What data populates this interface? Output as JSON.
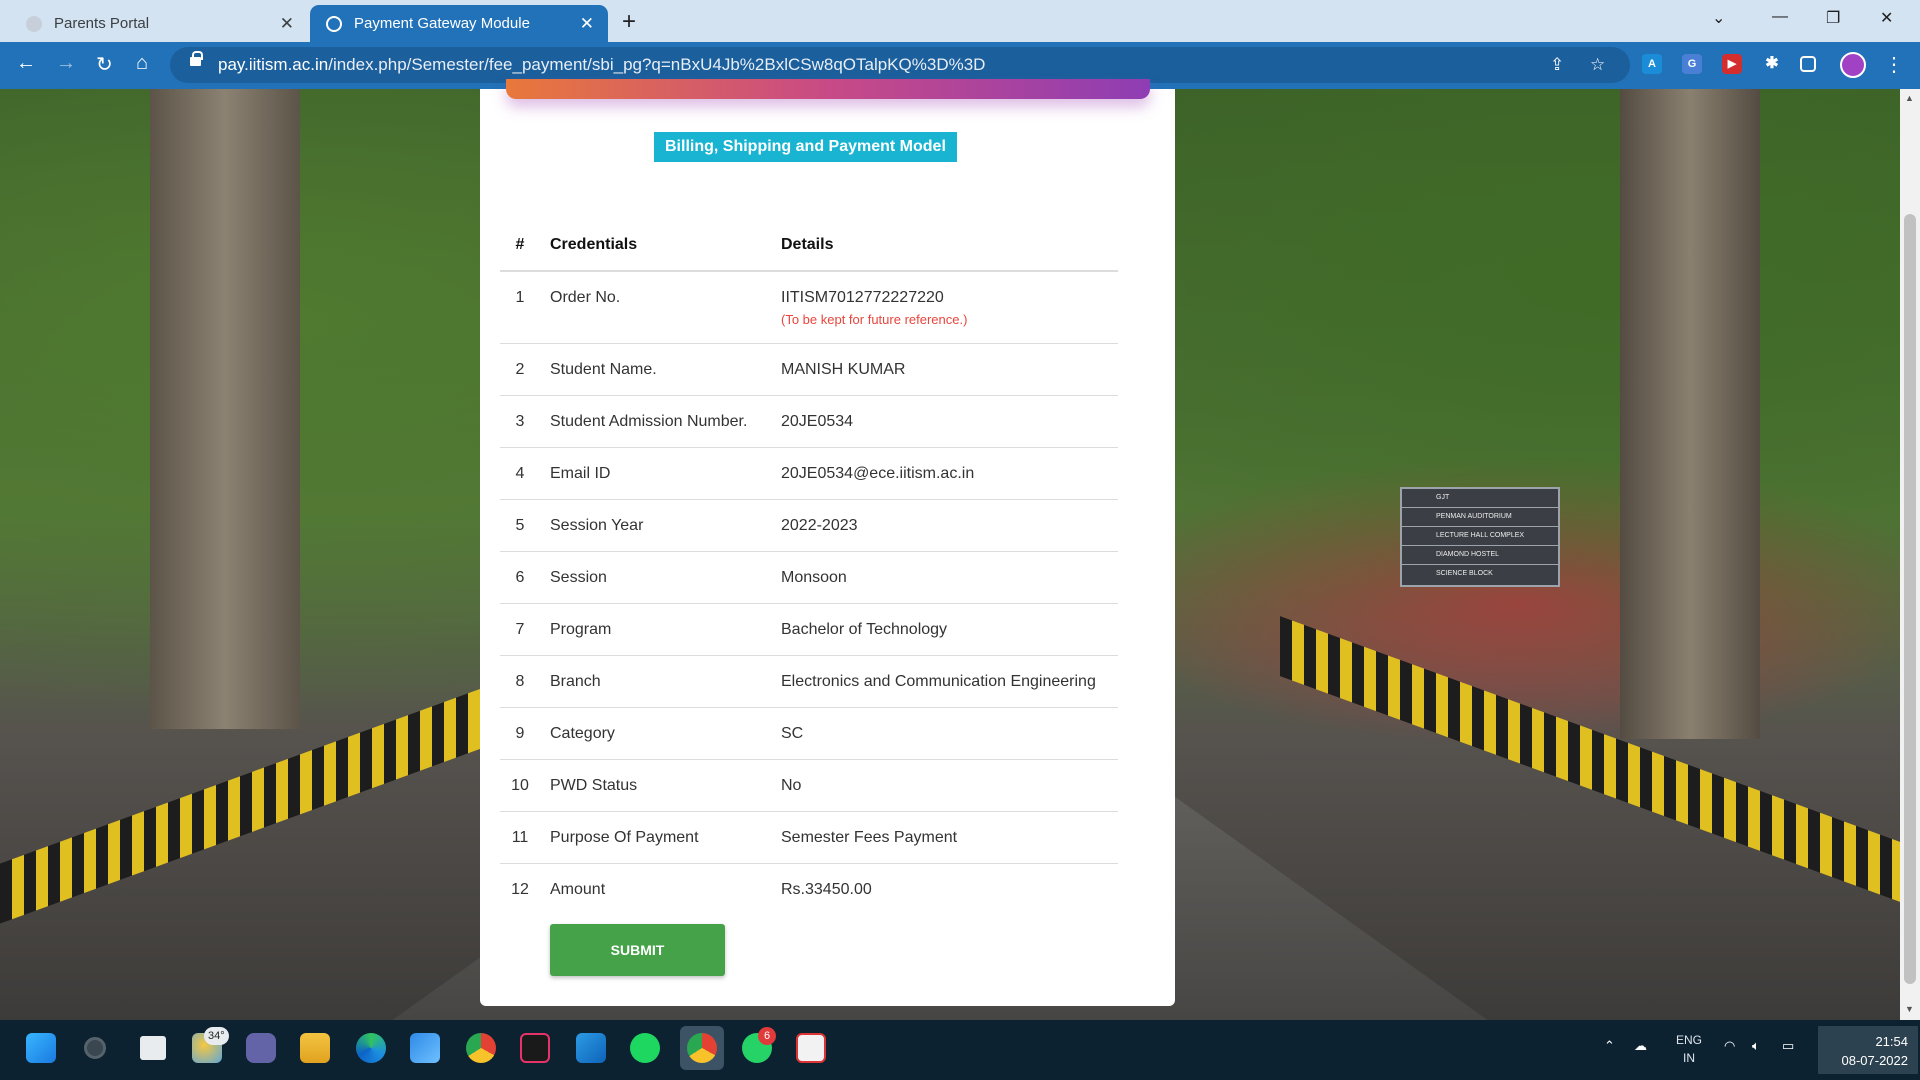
{
  "browser": {
    "tabs": [
      {
        "title": "Parents Portal",
        "active": false
      },
      {
        "title": "Payment Gateway Module",
        "active": true
      }
    ],
    "url_host": "pay.iitism.ac.in",
    "url_path": "/index.php/Semester/fee_payment/sbi_pg?q=nBxU4Jb%2BxlCSw8qOTalpKQ%3D%3D"
  },
  "scene_sign": [
    "GJT",
    "PENMAN AUDITORIUM",
    "LECTURE HALL COMPLEX",
    "DIAMOND HOSTEL",
    "SCIENCE BLOCK"
  ],
  "card": {
    "badge": "Billing, Shipping and Payment Model",
    "headers": {
      "num": "#",
      "credentials": "Credentials",
      "details": "Details"
    },
    "rows": [
      {
        "num": "1",
        "label": "Order No.",
        "value": "IITISM7012772227220",
        "note": "(To be kept for future reference.)"
      },
      {
        "num": "2",
        "label": "Student Name.",
        "value": "MANISH KUMAR"
      },
      {
        "num": "3",
        "label": "Student Admission Number.",
        "value": "20JE0534"
      },
      {
        "num": "4",
        "label": "Email ID",
        "value": "20JE0534@ece.iitism.ac.in"
      },
      {
        "num": "5",
        "label": "Session Year",
        "value": "2022-2023"
      },
      {
        "num": "6",
        "label": "Session",
        "value": "Monsoon"
      },
      {
        "num": "7",
        "label": "Program",
        "value": "Bachelor of Technology"
      },
      {
        "num": "8",
        "label": "Branch",
        "value": "Electronics and Communication Engineering"
      },
      {
        "num": "9",
        "label": "Category",
        "value": "SC"
      },
      {
        "num": "10",
        "label": "PWD Status",
        "value": "No"
      },
      {
        "num": "11",
        "label": "Purpose Of Payment",
        "value": "Semester Fees Payment"
      },
      {
        "num": "12",
        "label": "Amount",
        "value": "Rs.33450.00"
      }
    ],
    "submit_label": "SUBMIT"
  },
  "taskbar": {
    "weather_temp": "34°",
    "whatsapp_badge": "6",
    "lang_line1": "ENG",
    "lang_line2": "IN",
    "time": "21:54",
    "date": "08-07-2022"
  },
  "colors": {
    "browser_accent": "#2172b8",
    "badge": "#19b4d2",
    "submit": "#45a249",
    "note": "#e8453c"
  }
}
